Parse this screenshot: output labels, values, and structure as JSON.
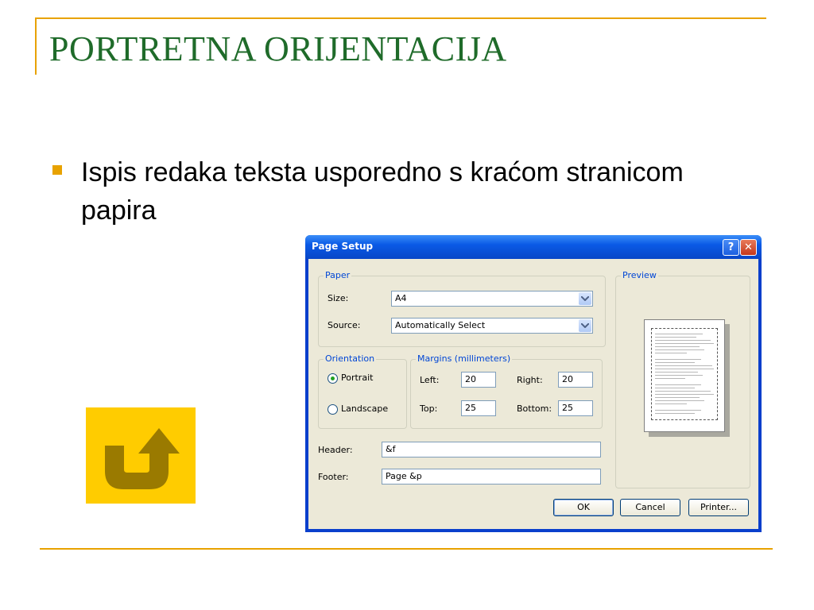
{
  "slide": {
    "title": "PORTRETNA ORIJENTACIJA",
    "bullet": "Ispis redaka teksta usporedno s kraćom stranicom papira",
    "return_icon": "u-turn-arrow-icon",
    "accent_color": "#e8a200",
    "title_color": "#1f6b2a"
  },
  "dialog": {
    "title": "Page Setup",
    "help_button": "?",
    "close_button": "✕",
    "paper": {
      "group_label": "Paper",
      "size_label": "Size:",
      "size_value": "A4",
      "source_label": "Source:",
      "source_value": "Automatically Select"
    },
    "orientation": {
      "group_label": "Orientation",
      "portrait_label": "Portrait",
      "landscape_label": "Landscape",
      "selected": "Portrait"
    },
    "margins": {
      "group_label": "Margins (millimeters)",
      "left_label": "Left:",
      "left_value": "20",
      "right_label": "Right:",
      "right_value": "20",
      "top_label": "Top:",
      "top_value": "25",
      "bottom_label": "Bottom:",
      "bottom_value": "25"
    },
    "header_label": "Header:",
    "header_value": "&f",
    "footer_label": "Footer:",
    "footer_value": "Page &p",
    "preview_label": "Preview",
    "ok_label": "OK",
    "cancel_label": "Cancel",
    "printer_label": "Printer..."
  }
}
